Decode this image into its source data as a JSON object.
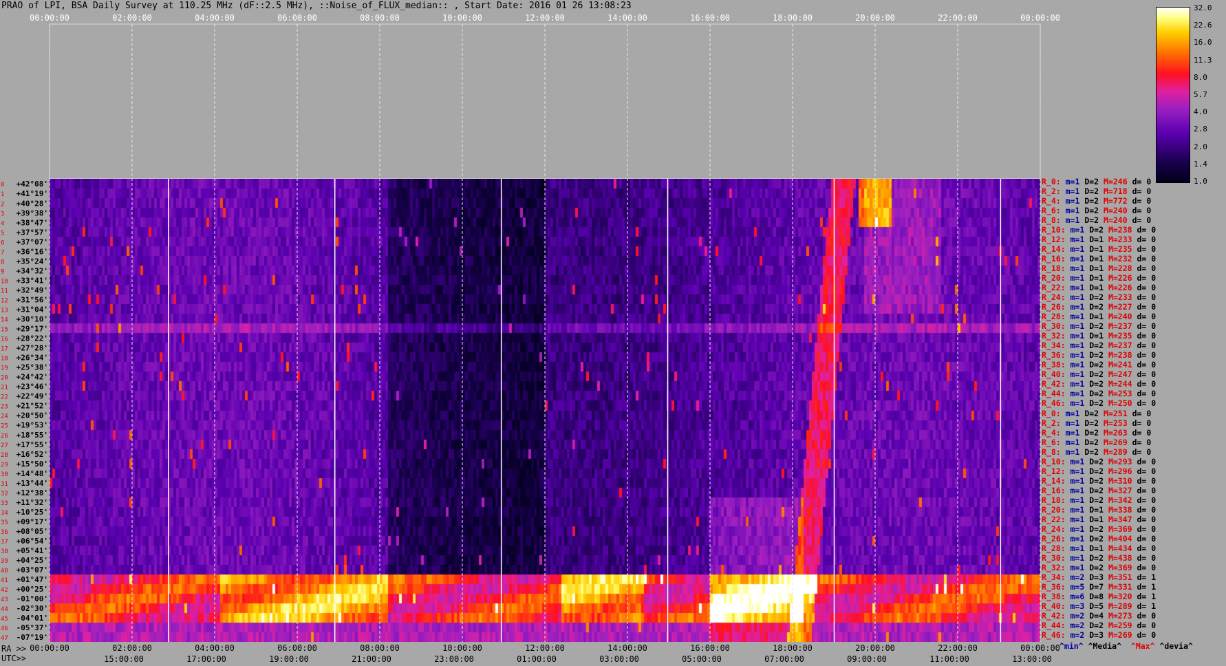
{
  "title": "PRAO of LPI, BSA Daily Survey at 110.25 MHz (dF::2.5 MHz), ::Noise_of_FLUX_median:: , Start Date: 2016 01 26 13:08:23",
  "chart_data": {
    "type": "heatmap",
    "title": "PRAO of LPI, BSA Daily Survey at 110.25 MHz (dF::2.5 MHz), ::Noise_of_FLUX_median:: , Start Date: 2016 01 26 13:08:23",
    "top_ra_ticks": [
      "00:00:00",
      "02:00:00",
      "04:00:00",
      "06:00:00",
      "08:00:00",
      "10:00:00",
      "12:00:00",
      "14:00:00",
      "16:00:00",
      "18:00:00",
      "20:00:00",
      "22:00:00",
      "00:00:00"
    ],
    "bottom_ra_ticks": [
      "00:00:00",
      "02:00:00",
      "04:00:00",
      "06:00:00",
      "08:00:00",
      "10:00:00",
      "12:00:00",
      "14:00:00",
      "16:00:00",
      "18:00:00",
      "20:00:00",
      "22:00:00",
      "00:00:00"
    ],
    "utc_ticks": [
      "15:00:00",
      "17:00:00",
      "19:00:00",
      "21:00:00",
      "23:00:00",
      "01:00:00",
      "03:00:00",
      "05:00:00",
      "07:00:00",
      "09:00:00",
      "11:00:00",
      "13:00:00"
    ],
    "ra_label": "RA >>",
    "utc_label": "UTC>>",
    "colorbar": {
      "scale": "log",
      "range": [
        1.0,
        32.0
      ],
      "ticks": [
        "32.0",
        "22.6",
        "16.0",
        "11.3",
        "8.0",
        "5.7",
        "4.0",
        "2.8",
        "2.0",
        "1.4",
        "1.0"
      ]
    },
    "declinations": [
      "+42°08'",
      "+41°19'",
      "+40°28'",
      "+39°38'",
      "+38°47'",
      "+37°57'",
      "+37°07'",
      "+36°16'",
      "+35°24'",
      "+34°32'",
      "+33°41'",
      "+32°49'",
      "+31°56'",
      "+31°04'",
      "+30°10'",
      "+29°17'",
      "+28°22'",
      "+27°28'",
      "+26°34'",
      "+25°38'",
      "+24°42'",
      "+23°46'",
      "+22°49'",
      "+21°52'",
      "+20°50'",
      "+19°53'",
      "+18°55'",
      "+17°55'",
      "+16°52'",
      "+15°50'",
      "+14°48'",
      "+13°44'",
      "+12°38'",
      "+11°32'",
      "+10°25'",
      "+09°17'",
      "+08°05'",
      "+06°54'",
      "+05°41'",
      "+04°25'",
      "+03°07'",
      "+01°47'",
      "+00°25'",
      "-01°00'",
      "-02°30'",
      "-04°01'",
      "-05°37'",
      "-07°19'"
    ],
    "row_index_labels": [
      "0",
      "1",
      "2",
      "3",
      "4",
      "5",
      "6",
      "7",
      "8",
      "9",
      "10",
      "11",
      "12",
      "13",
      "14",
      "15",
      "16",
      "17",
      "18",
      "19",
      "20",
      "21",
      "22",
      "23",
      "24",
      "25",
      "26",
      "27",
      "28",
      "29",
      "30",
      "31",
      "32",
      "33",
      "34",
      "35",
      "36",
      "37",
      "38",
      "39",
      "40",
      "41",
      "42",
      "43",
      "44",
      "45",
      "46",
      "47"
    ],
    "row_stats": [
      {
        "r": "R_0:",
        "m": "m=1",
        "d": "D=2",
        "M": "M=246",
        "dd": "d= 0"
      },
      {
        "r": "R_2:",
        "m": "m=1",
        "d": "D=2",
        "M": "M=718",
        "dd": "d= 0"
      },
      {
        "r": "R_4:",
        "m": "m=1",
        "d": "D=2",
        "M": "M=772",
        "dd": "d= 0"
      },
      {
        "r": "R_6:",
        "m": "m=1",
        "d": "D=2",
        "M": "M=240",
        "dd": "d= 0"
      },
      {
        "r": "R_8:",
        "m": "m=1",
        "d": "D=2",
        "M": "M=240",
        "dd": "d= 0"
      },
      {
        "r": "R_10:",
        "m": "m=1",
        "d": "D=2",
        "M": "M=238",
        "dd": "d= 0"
      },
      {
        "r": "R_12:",
        "m": "m=1",
        "d": "D=1",
        "M": "M=233",
        "dd": "d= 0"
      },
      {
        "r": "R_14:",
        "m": "m=1",
        "d": "D=1",
        "M": "M=235",
        "dd": "d= 0"
      },
      {
        "r": "R_16:",
        "m": "m=1",
        "d": "D=1",
        "M": "M=232",
        "dd": "d= 0"
      },
      {
        "r": "R_18:",
        "m": "m=1",
        "d": "D=1",
        "M": "M=228",
        "dd": "d= 0"
      },
      {
        "r": "R_20:",
        "m": "m=1",
        "d": "D=1",
        "M": "M=226",
        "dd": "d= 0"
      },
      {
        "r": "R_22:",
        "m": "m=1",
        "d": "D=1",
        "M": "M=226",
        "dd": "d= 0"
      },
      {
        "r": "R_24:",
        "m": "m=1",
        "d": "D=2",
        "M": "M=233",
        "dd": "d= 0"
      },
      {
        "r": "R_26:",
        "m": "m=1",
        "d": "D=2",
        "M": "M=227",
        "dd": "d= 0"
      },
      {
        "r": "R_28:",
        "m": "m=1",
        "d": "D=1",
        "M": "M=240",
        "dd": "d= 0"
      },
      {
        "r": "R_30:",
        "m": "m=1",
        "d": "D=2",
        "M": "M=237",
        "dd": "d= 0"
      },
      {
        "r": "R_32:",
        "m": "m=1",
        "d": "D=1",
        "M": "M=235",
        "dd": "d= 0"
      },
      {
        "r": "R_34:",
        "m": "m=1",
        "d": "D=2",
        "M": "M=237",
        "dd": "d= 0"
      },
      {
        "r": "R_36:",
        "m": "m=1",
        "d": "D=2",
        "M": "M=238",
        "dd": "d= 0"
      },
      {
        "r": "R_38:",
        "m": "m=1",
        "d": "D=2",
        "M": "M=241",
        "dd": "d= 0"
      },
      {
        "r": "R_40:",
        "m": "m=1",
        "d": "D=2",
        "M": "M=247",
        "dd": "d= 0"
      },
      {
        "r": "R_42:",
        "m": "m=1",
        "d": "D=2",
        "M": "M=244",
        "dd": "d= 0"
      },
      {
        "r": "R_44:",
        "m": "m=1",
        "d": "D=2",
        "M": "M=253",
        "dd": "d= 0"
      },
      {
        "r": "R_46:",
        "m": "m=1",
        "d": "D=2",
        "M": "M=250",
        "dd": "d= 0"
      },
      {
        "r": "R_0:",
        "m": "m=1",
        "d": "D=2",
        "M": "M=251",
        "dd": "d= 0"
      },
      {
        "r": "R_2:",
        "m": "m=1",
        "d": "D=2",
        "M": "M=253",
        "dd": "d= 0"
      },
      {
        "r": "R_4:",
        "m": "m=1",
        "d": "D=2",
        "M": "M=263",
        "dd": "d= 0"
      },
      {
        "r": "R_6:",
        "m": "m=1",
        "d": "D=2",
        "M": "M=269",
        "dd": "d= 0"
      },
      {
        "r": "R_8:",
        "m": "m=1",
        "d": "D=2",
        "M": "M=289",
        "dd": "d= 0"
      },
      {
        "r": "R_10:",
        "m": "m=1",
        "d": "D=2",
        "M": "M=293",
        "dd": "d= 0"
      },
      {
        "r": "R_12:",
        "m": "m=1",
        "d": "D=2",
        "M": "M=296",
        "dd": "d= 0"
      },
      {
        "r": "R_14:",
        "m": "m=1",
        "d": "D=2",
        "M": "M=310",
        "dd": "d= 0"
      },
      {
        "r": "R_16:",
        "m": "m=1",
        "d": "D=2",
        "M": "M=327",
        "dd": "d= 0"
      },
      {
        "r": "R_18:",
        "m": "m=1",
        "d": "D=2",
        "M": "M=342",
        "dd": "d= 0"
      },
      {
        "r": "R_20:",
        "m": "m=1",
        "d": "D=1",
        "M": "M=338",
        "dd": "d= 0"
      },
      {
        "r": "R_22:",
        "m": "m=1",
        "d": "D=1",
        "M": "M=347",
        "dd": "d= 0"
      },
      {
        "r": "R_24:",
        "m": "m=1",
        "d": "D=2",
        "M": "M=369",
        "dd": "d= 0"
      },
      {
        "r": "R_26:",
        "m": "m=1",
        "d": "D=2",
        "M": "M=404",
        "dd": "d= 0"
      },
      {
        "r": "R_28:",
        "m": "m=1",
        "d": "D=1",
        "M": "M=434",
        "dd": "d= 0"
      },
      {
        "r": "R_30:",
        "m": "m=1",
        "d": "D=2",
        "M": "M=438",
        "dd": "d= 0"
      },
      {
        "r": "R_32:",
        "m": "m=1",
        "d": "D=2",
        "M": "M=369",
        "dd": "d= 0"
      },
      {
        "r": "R_34:",
        "m": "m=2",
        "d": "D=3",
        "M": "M=351",
        "dd": "d= 1"
      },
      {
        "r": "R_36:",
        "m": "m=5",
        "d": "D=7",
        "M": "M=331",
        "dd": "d= 1"
      },
      {
        "r": "R_38:",
        "m": "m=6",
        "d": "D=8",
        "M": "M=320",
        "dd": "d= 1"
      },
      {
        "r": "R_40:",
        "m": "m=3",
        "d": "D=5",
        "M": "M=289",
        "dd": "d= 1"
      },
      {
        "r": "R_42:",
        "m": "m=2",
        "d": "D=4",
        "M": "M=273",
        "dd": "d= 0"
      },
      {
        "r": "R_44:",
        "m": "m=2",
        "d": "D=2",
        "M": "M=259",
        "dd": "d= 0"
      },
      {
        "r": "R_46:",
        "m": "m=2",
        "d": "D=3",
        "M": "M=269",
        "dd": "d= 0"
      }
    ],
    "stats_legend": {
      "min": "^min^",
      "median": "^Media^",
      "max": "^Max^",
      "dev": "^devia^"
    },
    "grid": true
  }
}
